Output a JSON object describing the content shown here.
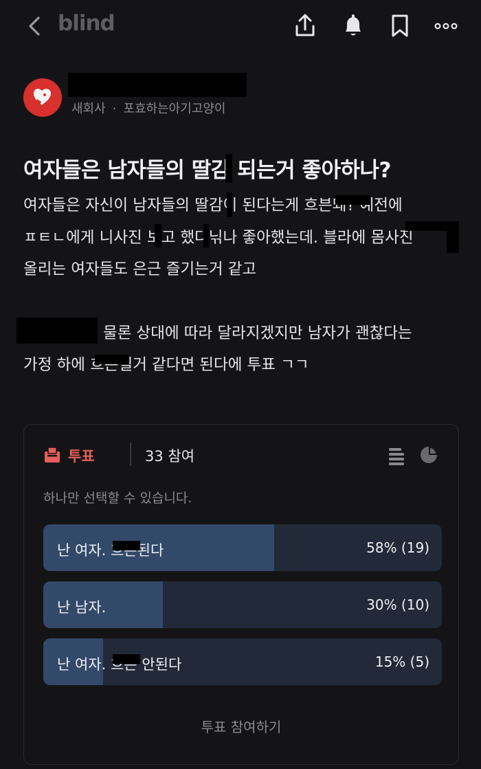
{
  "header": {
    "logo": "blind",
    "icons": [
      "back-chevron-icon",
      "share-icon",
      "bell-icon",
      "bookmark-icon",
      "more-icon"
    ]
  },
  "author": {
    "company": "새회사",
    "separator": "·",
    "nickname": "포효하는아기고양이",
    "avatar_color": "#d8302c"
  },
  "post": {
    "title": "여자들은 남자들의 딸감 되는거 좋아하나?",
    "lines": [
      "여자들은 자신이 남자들의 딸감이 된다는게 흐븐돼? 예전에",
      "ㅍㅌㄴ에게 니사진 보고 했다닊나 좋아했는데. 블라에 몸사진",
      "올리는 여자들도 은근 즐기는거 같고",
      "물론 상대에 따라 달라지겠지만 남자가 괜찮다는",
      "가정 하에 흐븐될거 같다면 된다에 투표 ㄱㄱ"
    ]
  },
  "poll": {
    "label": "투표",
    "count": "33 참여",
    "hint": "하나만 선택할 수 있습니다.",
    "options": [
      {
        "label": "난 여자. 흐븐된다",
        "percent_text": "58% (19)",
        "percent": 58
      },
      {
        "label": "난 남자.",
        "percent_text": "30% (10)",
        "percent": 30
      },
      {
        "label": "난 여자. 흐븐 안된다",
        "percent_text": "15% (5)",
        "percent": 15
      }
    ],
    "cta": "투표 참여하기",
    "accent": "#e5605a",
    "bar_fill": "#33496a",
    "bar_bg": "#222938",
    "icons": [
      "list-view-icon",
      "pie-chart-icon",
      "ballot-box-icon"
    ]
  }
}
